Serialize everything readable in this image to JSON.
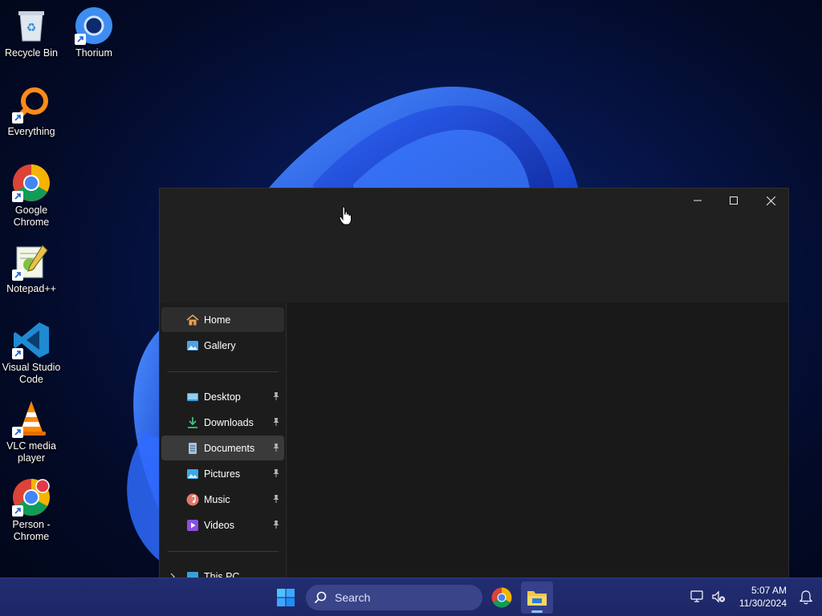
{
  "desktop": {
    "icons": [
      {
        "label": "Recycle Bin"
      },
      {
        "label": "Thorium"
      },
      {
        "label": "Everything"
      },
      {
        "label": "Google Chrome"
      },
      {
        "label": "Notepad++"
      },
      {
        "label": "Visual Studio Code"
      },
      {
        "label": "VLC media player"
      },
      {
        "label": "Person - Chrome"
      }
    ]
  },
  "explorer": {
    "nav": {
      "items": [
        {
          "label": "Home",
          "icon": "home-icon"
        },
        {
          "label": "Gallery",
          "icon": "gallery-icon"
        },
        {
          "label": "Desktop",
          "icon": "desktop-folder-icon",
          "pinned": true
        },
        {
          "label": "Downloads",
          "icon": "downloads-icon",
          "pinned": true
        },
        {
          "label": "Documents",
          "icon": "documents-icon",
          "pinned": true
        },
        {
          "label": "Pictures",
          "icon": "pictures-icon",
          "pinned": true
        },
        {
          "label": "Music",
          "icon": "music-icon",
          "pinned": true
        },
        {
          "label": "Videos",
          "icon": "videos-icon",
          "pinned": true
        },
        {
          "label": "This PC",
          "icon": "this-pc-icon"
        }
      ]
    }
  },
  "taskbar": {
    "search_label": "Search",
    "time": "5:07 AM",
    "date": "11/30/2024"
  },
  "colors": {
    "taskbar": "#202a6b",
    "window_bg": "#1c1c1c",
    "accent": "#0078d4"
  }
}
